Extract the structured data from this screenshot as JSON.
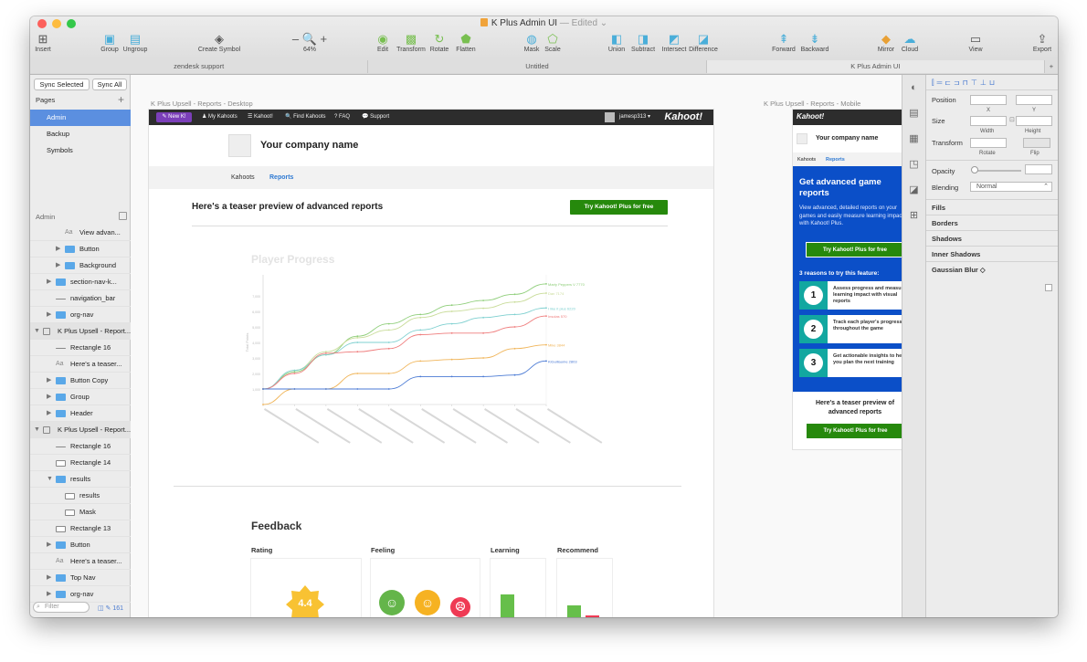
{
  "window": {
    "doc_title": "K Plus Admin UI",
    "edited": "— Edited ⌄"
  },
  "toolbar": [
    {
      "label": "Insert",
      "icon": "insert-icon",
      "glyph": "⊞"
    },
    {
      "label": "Group",
      "icon": "group-icon",
      "glyph": "▣"
    },
    {
      "label": "Ungroup",
      "icon": "ungroup-icon",
      "glyph": "▤"
    },
    {
      "label": "Create Symbol",
      "icon": "symbol-icon",
      "glyph": "◈"
    },
    {
      "label": "64%",
      "icon": "zoom-icon",
      "glyph": "– 🔍 +"
    },
    {
      "label": "Edit",
      "icon": "edit-icon",
      "glyph": "◉"
    },
    {
      "label": "Transform",
      "icon": "transform-icon",
      "glyph": "▩"
    },
    {
      "label": "Rotate",
      "icon": "rotate-icon",
      "glyph": "↻"
    },
    {
      "label": "Flatten",
      "icon": "flatten-icon",
      "glyph": "⬟"
    },
    {
      "label": "Mask",
      "icon": "mask-icon",
      "glyph": "◍"
    },
    {
      "label": "Scale",
      "icon": "scale-icon",
      "glyph": "⬠"
    },
    {
      "label": "Union",
      "icon": "union-icon",
      "glyph": "◧"
    },
    {
      "label": "Subtract",
      "icon": "subtract-icon",
      "glyph": "◨"
    },
    {
      "label": "Intersect",
      "icon": "intersect-icon",
      "glyph": "◩"
    },
    {
      "label": "Difference",
      "icon": "difference-icon",
      "glyph": "◪"
    },
    {
      "label": "Forward",
      "icon": "forward-icon",
      "glyph": "⇞"
    },
    {
      "label": "Backward",
      "icon": "backward-icon",
      "glyph": "⇟"
    },
    {
      "label": "Mirror",
      "icon": "mirror-icon",
      "glyph": "◆"
    },
    {
      "label": "Cloud",
      "icon": "cloud-icon",
      "glyph": "☁"
    },
    {
      "label": "View",
      "icon": "view-icon",
      "glyph": "▭"
    },
    {
      "label": "Export",
      "icon": "export-icon",
      "glyph": "⇪"
    }
  ],
  "doc_tabs": [
    "zendesk support",
    "Untitled",
    "K Plus Admin UI"
  ],
  "sidebar": {
    "sync_selected": "Sync Selected",
    "sync_all": "Sync All",
    "pages_header": "Pages",
    "pages": [
      "Admin",
      "Backup",
      "Symbols"
    ],
    "artboard_header": "Admin",
    "layers": [
      {
        "name": "View advan...",
        "type": "text",
        "indent": 1,
        "twisty": ""
      },
      {
        "name": "Button",
        "type": "folder",
        "indent": 1,
        "twisty": "▶"
      },
      {
        "name": "Background",
        "type": "folder",
        "indent": 1,
        "twisty": "▶"
      },
      {
        "name": "section-nav-k...",
        "type": "folder",
        "indent": 0,
        "twisty": "▶"
      },
      {
        "name": "navigation_bar",
        "type": "line",
        "indent": 0,
        "twisty": ""
      },
      {
        "name": "org-nav",
        "type": "folder",
        "indent": 0,
        "twisty": "▶"
      },
      {
        "name": "K Plus Upsell - Report...",
        "type": "art",
        "indent": -1,
        "twisty": "▼"
      },
      {
        "name": "Rectangle 16",
        "type": "line",
        "indent": 0,
        "twisty": ""
      },
      {
        "name": "Here's a teaser...",
        "type": "text",
        "indent": 0,
        "twisty": ""
      },
      {
        "name": "Button Copy",
        "type": "folder",
        "indent": 0,
        "twisty": "▶"
      },
      {
        "name": "Group",
        "type": "folder",
        "indent": 0,
        "twisty": "▶"
      },
      {
        "name": "Header",
        "type": "folder",
        "indent": 0,
        "twisty": "▶"
      },
      {
        "name": "K Plus Upsell - Report...",
        "type": "art",
        "indent": -1,
        "twisty": "▼"
      },
      {
        "name": "Rectangle 16",
        "type": "line",
        "indent": 0,
        "twisty": ""
      },
      {
        "name": "Rectangle 14",
        "type": "rect",
        "indent": 0,
        "twisty": ""
      },
      {
        "name": "results",
        "type": "folder",
        "indent": 0,
        "twisty": "▼"
      },
      {
        "name": "results",
        "type": "rect",
        "indent": 1,
        "twisty": ""
      },
      {
        "name": "Mask",
        "type": "rect",
        "indent": 1,
        "twisty": ""
      },
      {
        "name": "Rectangle 13",
        "type": "rect",
        "indent": 0,
        "twisty": ""
      },
      {
        "name": "Button",
        "type": "folder",
        "indent": 0,
        "twisty": "▶"
      },
      {
        "name": "Here's a teaser...",
        "type": "text",
        "indent": 0,
        "twisty": ""
      },
      {
        "name": "Top Nav",
        "type": "folder",
        "indent": 0,
        "twisty": "▶"
      },
      {
        "name": "org-nav",
        "type": "folder",
        "indent": 0,
        "twisty": "▶"
      }
    ],
    "filter_placeholder": "Filter",
    "count": "161"
  },
  "desktop": {
    "artboard_label": "K Plus Upsell - Reports - Desktop",
    "nav": {
      "new": "✎ New K!",
      "items": [
        "♟ My Kahoots",
        "☰ Kahoot!",
        "🔍 Find Kahoots",
        "? FAQ",
        "💬 Support"
      ],
      "user": "jamesp313 ▾",
      "logo": "Kahoot!"
    },
    "company": "Your company name",
    "tabs": [
      "Kahoots",
      "Reports"
    ],
    "teaser": "Here's a teaser preview of advanced reports",
    "try_button": "Try Kahoot! Plus for free",
    "player_progress": "Player Progress",
    "feedback": {
      "title": "Feedback",
      "columns": [
        "Rating",
        "Feeling",
        "Learning",
        "Recommend"
      ],
      "rating": "4.4",
      "learning": [
        0.9,
        0.15
      ],
      "recommend": [
        0.65,
        0.4
      ]
    }
  },
  "chart_data": {
    "type": "line",
    "title": "Player Progress",
    "ylabel": "Total Points",
    "categories": [
      "1",
      "2",
      "3",
      "4",
      "5",
      "6",
      "7",
      "8",
      "9",
      "10"
    ],
    "ylim": [
      0,
      8000
    ],
    "yticks": [
      "7,000",
      "6,000",
      "5,000",
      "4,000",
      "3,000",
      "2,000",
      "1,000"
    ],
    "series": [
      {
        "name": "Marty Peppers V 7770",
        "color": "#8fce7a",
        "values": [
          1000,
          2100,
          3200,
          4400,
          5200,
          5800,
          6400,
          6700,
          7100,
          7770
        ]
      },
      {
        "name": "Dan 7174",
        "color": "#c9dc9a",
        "values": [
          1000,
          2200,
          3400,
          4300,
          4800,
          5600,
          6000,
          6200,
          6600,
          7174
        ]
      },
      {
        "name": "I like it plus 6220",
        "color": "#7fd0d0",
        "values": [
          1000,
          2200,
          3200,
          4000,
          4000,
          4800,
          5200,
          5600,
          5800,
          6220
        ]
      },
      {
        "name": "Insolas 570",
        "color": "#ef7d7d",
        "values": [
          1000,
          2000,
          3300,
          3400,
          3600,
          4500,
          4600,
          4600,
          5000,
          5700
        ]
      },
      {
        "name": "Mike 3844",
        "color": "#f0b55a",
        "values": [
          0,
          1000,
          1000,
          2000,
          2000,
          2800,
          2900,
          3000,
          3600,
          3844
        ]
      },
      {
        "name": "KiGuillaume 2803",
        "color": "#4a7ad4",
        "values": [
          1000,
          1000,
          1000,
          1000,
          1000,
          1800,
          1800,
          1800,
          1900,
          2803
        ]
      }
    ]
  },
  "mobile": {
    "artboard_label": "K Plus Upsell - Reports - Mobile",
    "logo": "Kahoot!",
    "company": "Your company name",
    "tabs": [
      "Kahoots",
      "Reports"
    ],
    "hero_title": "Get advanced game reports",
    "hero_text": "View advanced, detailed reports on your games and easily measure learning impact with Kahoot! Plus.",
    "try_button": "Try Kahoot! Plus for free",
    "reasons_title": "3 reasons to try this feature:",
    "reasons": [
      {
        "num": "1",
        "text": "Assess progress and measure learning impact with visual reports"
      },
      {
        "num": "2",
        "text": "Track each player's progress throughout the game"
      },
      {
        "num": "3",
        "text": "Get actionable insights to help you plan the next training"
      }
    ],
    "teaser": "Here's a teaser preview of advanced reports",
    "try_button2": "Try Kahoot! Plus for free"
  },
  "inspector": {
    "position": "Position",
    "size": "Size",
    "transform": "Transform",
    "x": "X",
    "y": "Y",
    "width": "Width",
    "height": "Height",
    "rotate": "Rotate",
    "flip": "Flip",
    "opacity": "Opacity",
    "blending": "Blending",
    "blending_value": "Normal",
    "sections": [
      "Fills",
      "Borders",
      "Shadows",
      "Inner Shadows",
      "Gaussian Blur ◇"
    ]
  }
}
